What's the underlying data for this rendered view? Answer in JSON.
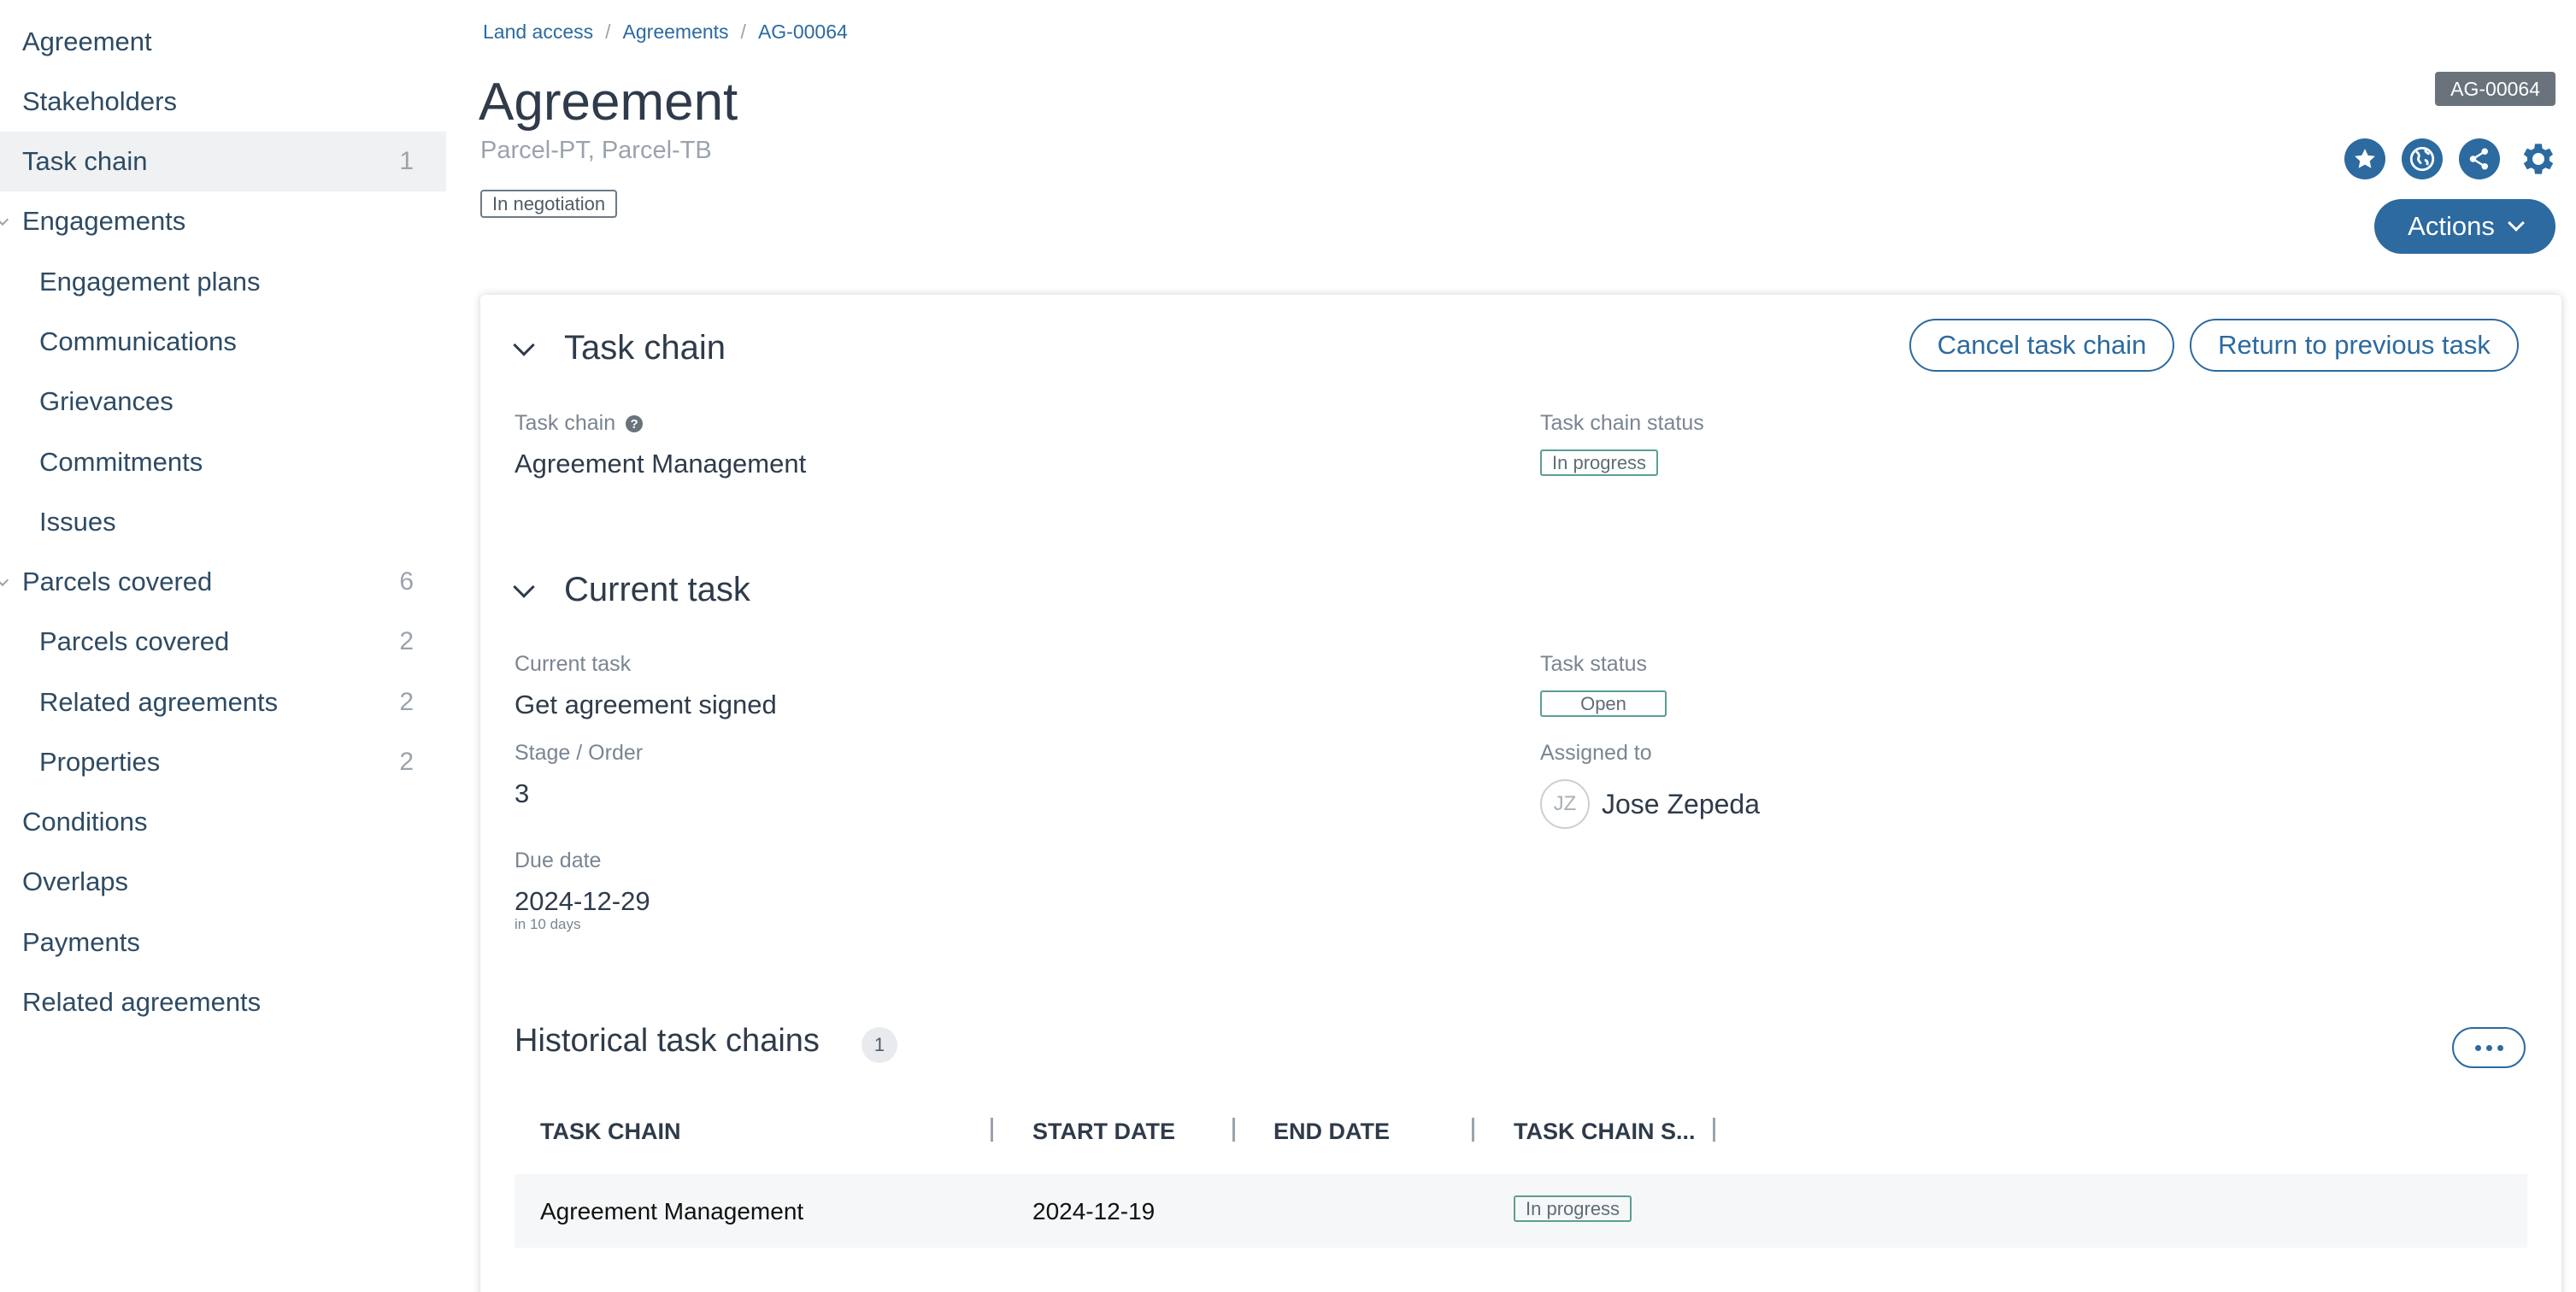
{
  "sidebar": {
    "items": [
      {
        "label": "Agreement",
        "count": ""
      },
      {
        "label": "Stakeholders",
        "count": ""
      },
      {
        "label": "Task chain",
        "count": "1"
      },
      {
        "label": "Engagements",
        "count": ""
      },
      {
        "label": "Engagement plans",
        "count": ""
      },
      {
        "label": "Communications",
        "count": ""
      },
      {
        "label": "Grievances",
        "count": ""
      },
      {
        "label": "Commitments",
        "count": ""
      },
      {
        "label": "Issues",
        "count": ""
      },
      {
        "label": "Parcels covered",
        "count": "6"
      },
      {
        "label": "Parcels covered",
        "count": "2"
      },
      {
        "label": "Related agreements",
        "count": "2"
      },
      {
        "label": "Properties",
        "count": "2"
      },
      {
        "label": "Conditions",
        "count": ""
      },
      {
        "label": "Overlaps",
        "count": ""
      },
      {
        "label": "Payments",
        "count": ""
      },
      {
        "label": "Related agreements",
        "count": ""
      }
    ]
  },
  "breadcrumb": [
    "Land access",
    "Agreements",
    "AG-00064"
  ],
  "header": {
    "title": "Agreement",
    "subtitle": "Parcel-PT, Parcel-TB",
    "status": "In negotiation",
    "id_badge": "AG-00064",
    "actions_label": "Actions"
  },
  "task_chain_section": {
    "title": "Task chain",
    "cancel_label": "Cancel task chain",
    "return_label": "Return to previous task",
    "task_chain_label": "Task chain",
    "task_chain_value": "Agreement Management",
    "status_label": "Task chain status",
    "status_value": "In progress"
  },
  "current_task_section": {
    "title": "Current task",
    "current_task_label": "Current task",
    "current_task_value": "Get agreement signed",
    "task_status_label": "Task status",
    "task_status_value": "Open",
    "stage_label": "Stage / Order",
    "stage_value": "3",
    "assigned_label": "Assigned to",
    "assigned_initials": "JZ",
    "assigned_name": "Jose Zepeda",
    "due_label": "Due date",
    "due_value": "2024-12-29",
    "due_note": "in 10 days"
  },
  "historical": {
    "title": "Historical task chains",
    "count": "1",
    "columns": [
      "TASK CHAIN",
      "START DATE",
      "END DATE",
      "TASK CHAIN S..."
    ],
    "rows": [
      {
        "task_chain": "Agreement Management",
        "start_date": "2024-12-19",
        "end_date": "",
        "status": "In progress"
      }
    ]
  },
  "colors": {
    "accent": "#2c6aa0",
    "status_green": "#5b9e94",
    "badge_gray": "#6a737c"
  }
}
